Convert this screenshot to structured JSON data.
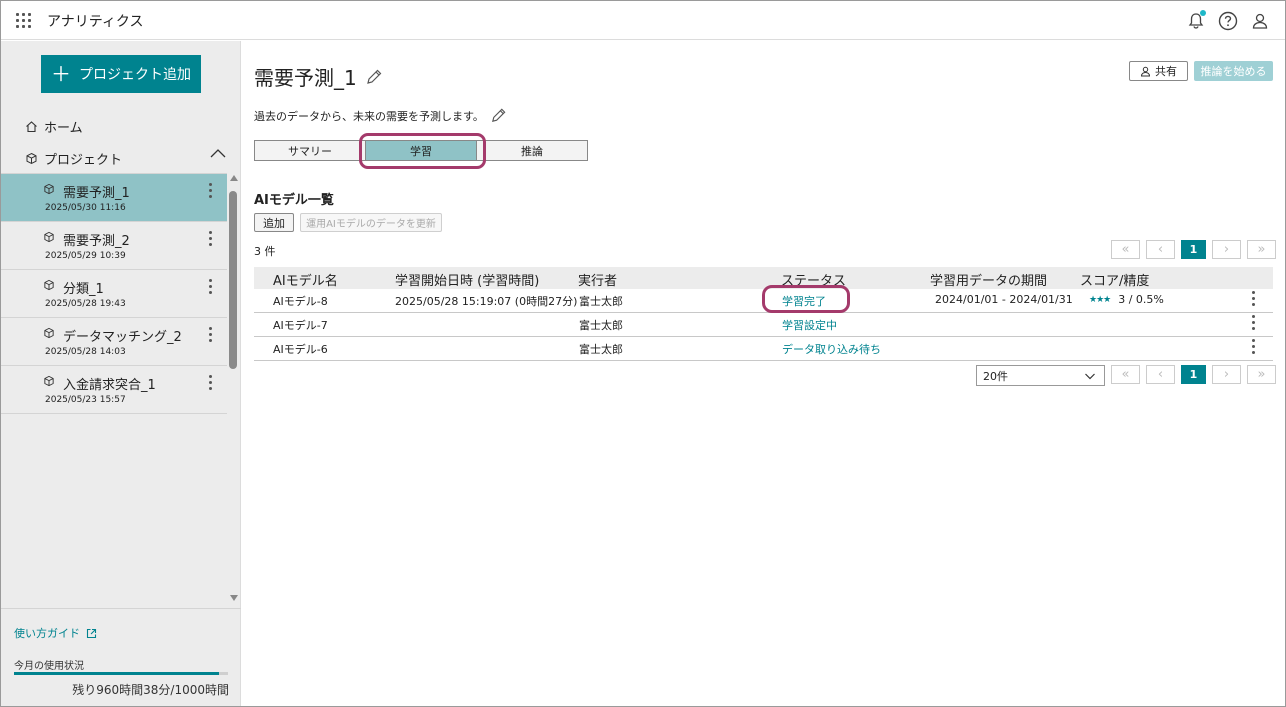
{
  "app": {
    "title": "アナリティクス"
  },
  "sidebar": {
    "add_project_label": "プロジェクト追加",
    "home_label": "ホーム",
    "projects_label": "プロジェクト",
    "projects": [
      {
        "name": "需要予測_1",
        "date": "2025/05/30 11:16",
        "active": true
      },
      {
        "name": "需要予測_2",
        "date": "2025/05/29 10:39",
        "active": false
      },
      {
        "name": "分類_1",
        "date": "2025/05/28 19:43",
        "active": false
      },
      {
        "name": "データマッチング_2",
        "date": "2025/05/28 14:03",
        "active": false
      },
      {
        "name": "入金請求突合_1",
        "date": "2025/05/23 15:57",
        "active": false
      }
    ],
    "guide_label": "使い方ガイド",
    "usage_label": "今月の使用状況",
    "usage_text": "残り960時間38分/1000時間",
    "usage_fraction": 0.96
  },
  "main": {
    "title": "需要予測_1",
    "share_label": "共有",
    "start_inference_label": "推論を始める",
    "description": "過去のデータから、未来の需要を予測します。",
    "tabs": [
      {
        "label": "サマリー",
        "active": false
      },
      {
        "label": "学習",
        "active": true
      },
      {
        "label": "推論",
        "active": false
      }
    ],
    "section_title": "AIモデル一覧",
    "add_label": "追加",
    "update_label": "運用AIモデルのデータを更新",
    "count_text": "3 件",
    "columns": [
      "AIモデル名",
      "学習開始日時 (学習時間)",
      "実行者",
      "ステータス",
      "学習用データの期間",
      "スコア/精度"
    ],
    "rows": [
      {
        "name": "AIモデル-8",
        "started": "2025/05/28 15:19:07 (0時間27分)",
        "executor": "富士太郎",
        "status": "学習完了",
        "period": "2024/01/01 - 2024/01/31",
        "stars": "★★★",
        "score": "3 / 0.5%"
      },
      {
        "name": "AIモデル-7",
        "started": "",
        "executor": "富士太郎",
        "status": "学習設定中",
        "period": "",
        "stars": "",
        "score": ""
      },
      {
        "name": "AIモデル-6",
        "started": "",
        "executor": "富士太郎",
        "status": "データ取り込み待ち",
        "period": "",
        "stars": "",
        "score": ""
      }
    ],
    "pager": {
      "first": "«",
      "prev": "‹",
      "page": "1",
      "next": "›",
      "last": "»"
    },
    "per_page": "20件"
  },
  "colors": {
    "accent": "#00838f",
    "active_tab": "#8fc2c6",
    "highlight": "#a43a6b"
  }
}
